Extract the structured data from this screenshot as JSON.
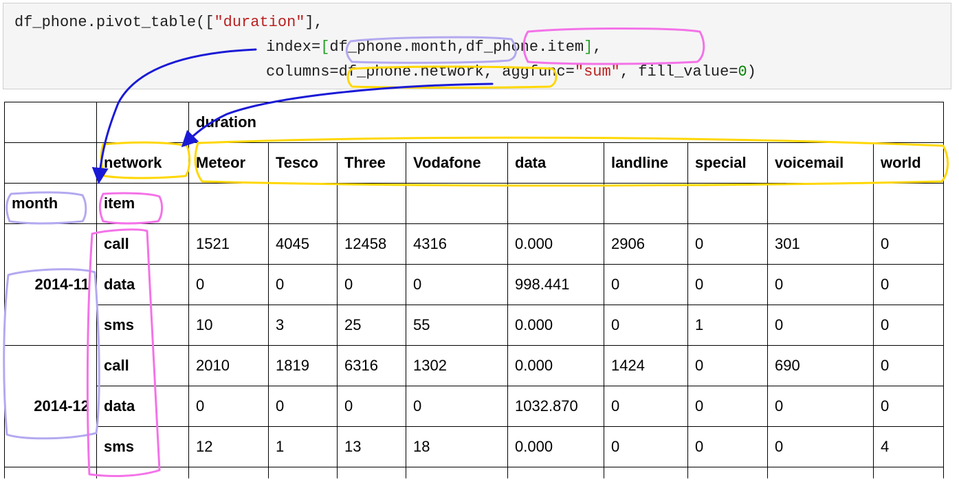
{
  "code": {
    "line1": {
      "prefix": "df_phone.pivot_table([",
      "str": "\"duration\"",
      "suffix": "],"
    },
    "line2": {
      "indent": "               ",
      "prefix": "index=",
      "lb": "[",
      "arg1": "df_phone.month",
      "comma": ",",
      "arg2": "df_phone.item",
      "rb": "]",
      "suffix": ","
    },
    "line3": {
      "indent": "               ",
      "prefix": "columns=df_phone.network, aggfunc=",
      "str": "\"sum\"",
      "mid": ", fill_value=",
      "num": "0",
      "suffix": ")"
    }
  },
  "table": {
    "value_header": "duration",
    "columns_name": "network",
    "columns": [
      "Meteor",
      "Tesco",
      "Three",
      "Vodafone",
      "data",
      "landline",
      "special",
      "voicemail",
      "world"
    ],
    "index_names": [
      "month",
      "item"
    ],
    "groups": [
      {
        "month": "2014-11",
        "rows": [
          {
            "item": "call",
            "values": [
              "1521",
              "4045",
              "12458",
              "4316",
              "0.000",
              "2906",
              "0",
              "301",
              "0"
            ]
          },
          {
            "item": "data",
            "values": [
              "0",
              "0",
              "0",
              "0",
              "998.441",
              "0",
              "0",
              "0",
              "0"
            ]
          },
          {
            "item": "sms",
            "values": [
              "10",
              "3",
              "25",
              "55",
              "0.000",
              "0",
              "1",
              "0",
              "0"
            ]
          }
        ]
      },
      {
        "month": "2014-12",
        "rows": [
          {
            "item": "call",
            "values": [
              "2010",
              "1819",
              "6316",
              "1302",
              "0.000",
              "1424",
              "0",
              "690",
              "0"
            ]
          },
          {
            "item": "data",
            "values": [
              "0",
              "0",
              "0",
              "0",
              "1032.870",
              "0",
              "0",
              "0",
              "0"
            ]
          },
          {
            "item": "sms",
            "values": [
              "12",
              "1",
              "13",
              "18",
              "0.000",
              "0",
              "0",
              "0",
              "4"
            ]
          }
        ]
      }
    ]
  },
  "annotation_colors": {
    "month_box": "#b3a9f0",
    "item_box": "#f472e8",
    "network_box": "#ffd700",
    "arrow": "#1a1ad6"
  }
}
